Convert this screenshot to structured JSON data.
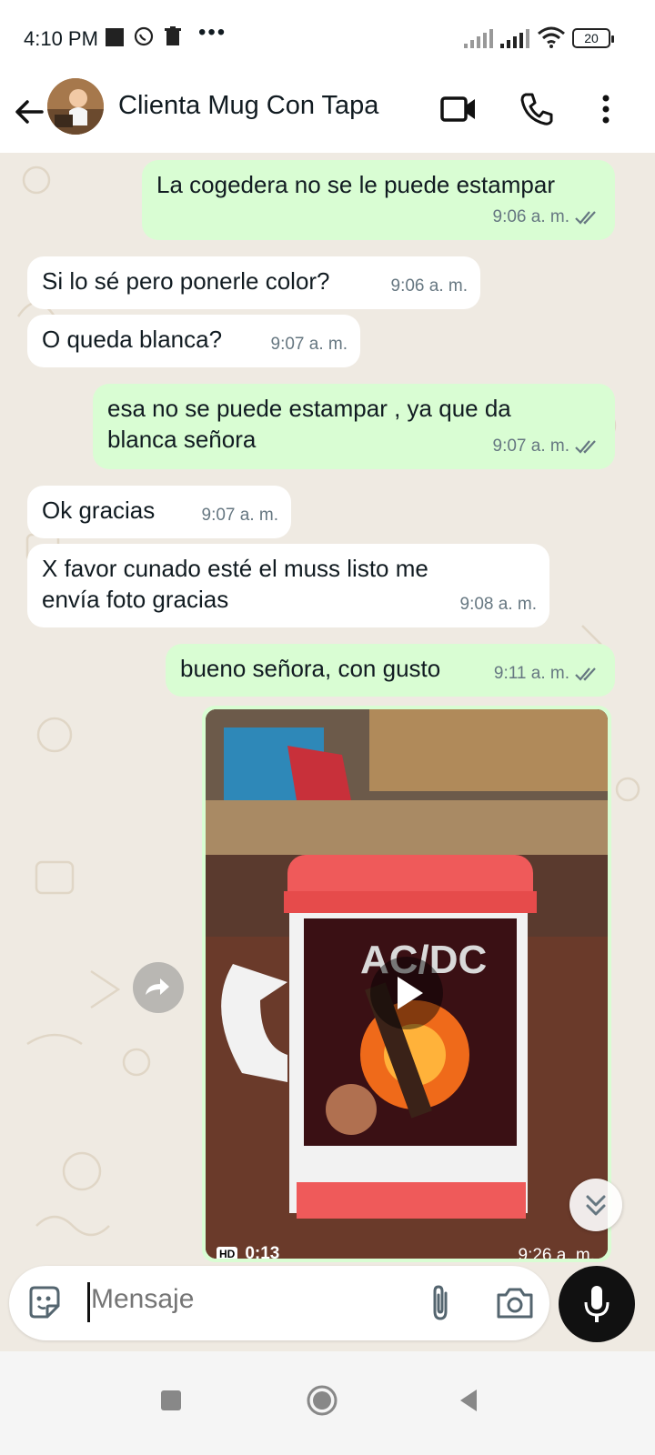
{
  "status_bar": {
    "time": "4:10 PM",
    "battery": "20"
  },
  "header": {
    "contact_name": "Clienta Mug Con Tapa"
  },
  "messages": [
    {
      "dir": "out",
      "text": "La cogedera no se le puede estampar",
      "time": "9:06 a. m."
    },
    {
      "dir": "in",
      "text": "Si lo sé pero ponerle color?",
      "time": "9:06 a. m."
    },
    {
      "dir": "in",
      "text": "O queda blanca?",
      "time": "9:07 a. m."
    },
    {
      "dir": "out",
      "text": "esa no se puede estampar , ya que da blanca señora",
      "time": "9:07 a. m."
    },
    {
      "dir": "in",
      "text": "Ok gracias",
      "time": "9:07 a. m."
    },
    {
      "dir": "in",
      "text": "X favor cunado esté el muss listo me envía foto gracias",
      "time": "9:08 a. m."
    },
    {
      "dir": "out",
      "text": "bueno señora, con gusto",
      "time": "9:11 a. m."
    }
  ],
  "video": {
    "hd_label": "HD",
    "duration": "0:13",
    "time": "9:26 a. m."
  },
  "composer": {
    "placeholder": "Mensaje"
  },
  "colors": {
    "outgoing": "#d9fdd3",
    "incoming": "#ffffff",
    "wallpaper": "#efeae2",
    "ticks": "#667781"
  },
  "icons": [
    "back-icon",
    "video-call-icon",
    "phone-icon",
    "more-icon",
    "forward-icon",
    "play-icon",
    "double-chevron-down-icon",
    "sticker-icon",
    "attach-icon",
    "camera-icon",
    "mic-icon"
  ]
}
